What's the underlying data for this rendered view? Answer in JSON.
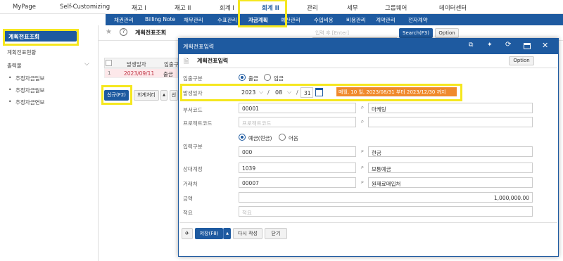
{
  "topnav": {
    "items": [
      "MyPage",
      "Self-Customizing",
      "재고 I",
      "재고 II",
      "회계 I",
      "회계 II",
      "관리",
      "세무",
      "그룹웨어",
      "데이터센터"
    ]
  },
  "subnav": {
    "items": [
      "채권관리",
      "Billing Note",
      "채무관리",
      "수표관리",
      "자금계획",
      "예산관리",
      "수입비용",
      "비용관리",
      "계약관리",
      "전자계약"
    ]
  },
  "sidebar": {
    "active": "계획전표조회",
    "items": [
      "계획전표현황"
    ],
    "group_label": "출력물",
    "sub_items": [
      "추정자금일보",
      "추정자금월보",
      "추정자금연보"
    ]
  },
  "toolbar": {
    "page_title": "계획전표조회",
    "help": "?",
    "search_placeholder": "입력 후 [Enter]",
    "search_button": "Search(F3)",
    "option_button": "Option"
  },
  "table": {
    "headers": [
      "발생일자",
      "입출구"
    ],
    "row": {
      "num": "1",
      "date": "2023/09/11",
      "type": "출금"
    }
  },
  "bottom_bar": {
    "new_button": "신규(F2)",
    "accounting_button": "회계처리",
    "caret": "▲",
    "extra": "선"
  },
  "modal": {
    "window_title": "계획전표입력",
    "header_title": "계획전표입력",
    "option_button": "Option",
    "fields": {
      "inout": {
        "label": "입출구분",
        "options": [
          "출금",
          "입금"
        ]
      },
      "date": {
        "label": "발생일자",
        "year": "2023",
        "month": "08",
        "day": "31",
        "sep": "/",
        "note": "매월, 10 일, 2023/08/31 부터 2023/12/30 까지"
      },
      "dept": {
        "label": "부서코드",
        "code": "00001",
        "name": "마케팅"
      },
      "project": {
        "label": "프로젝트코드",
        "placeholder": "프로젝트코드"
      },
      "input_type": {
        "label": "입력구분",
        "options": [
          "예금(현금)",
          "어음"
        ],
        "code": "000",
        "name": "현금"
      },
      "counter": {
        "label": "상대계정",
        "code": "1039",
        "name": "보통예금"
      },
      "vendor": {
        "label": "거래처",
        "code": "00007",
        "name": "원재료매입처"
      },
      "amount": {
        "label": "금액",
        "value": "1,000,000.00"
      },
      "memo": {
        "label": "적요",
        "placeholder": "적요"
      }
    },
    "footer": {
      "save_button": "저장(F8)",
      "caret": "▲",
      "rewrite_button": "다시 작성",
      "close_button": "닫기"
    }
  },
  "colors": {
    "primary": "#1e5aa0",
    "highlight": "#f5e71f",
    "badge": "#f08a2c"
  }
}
